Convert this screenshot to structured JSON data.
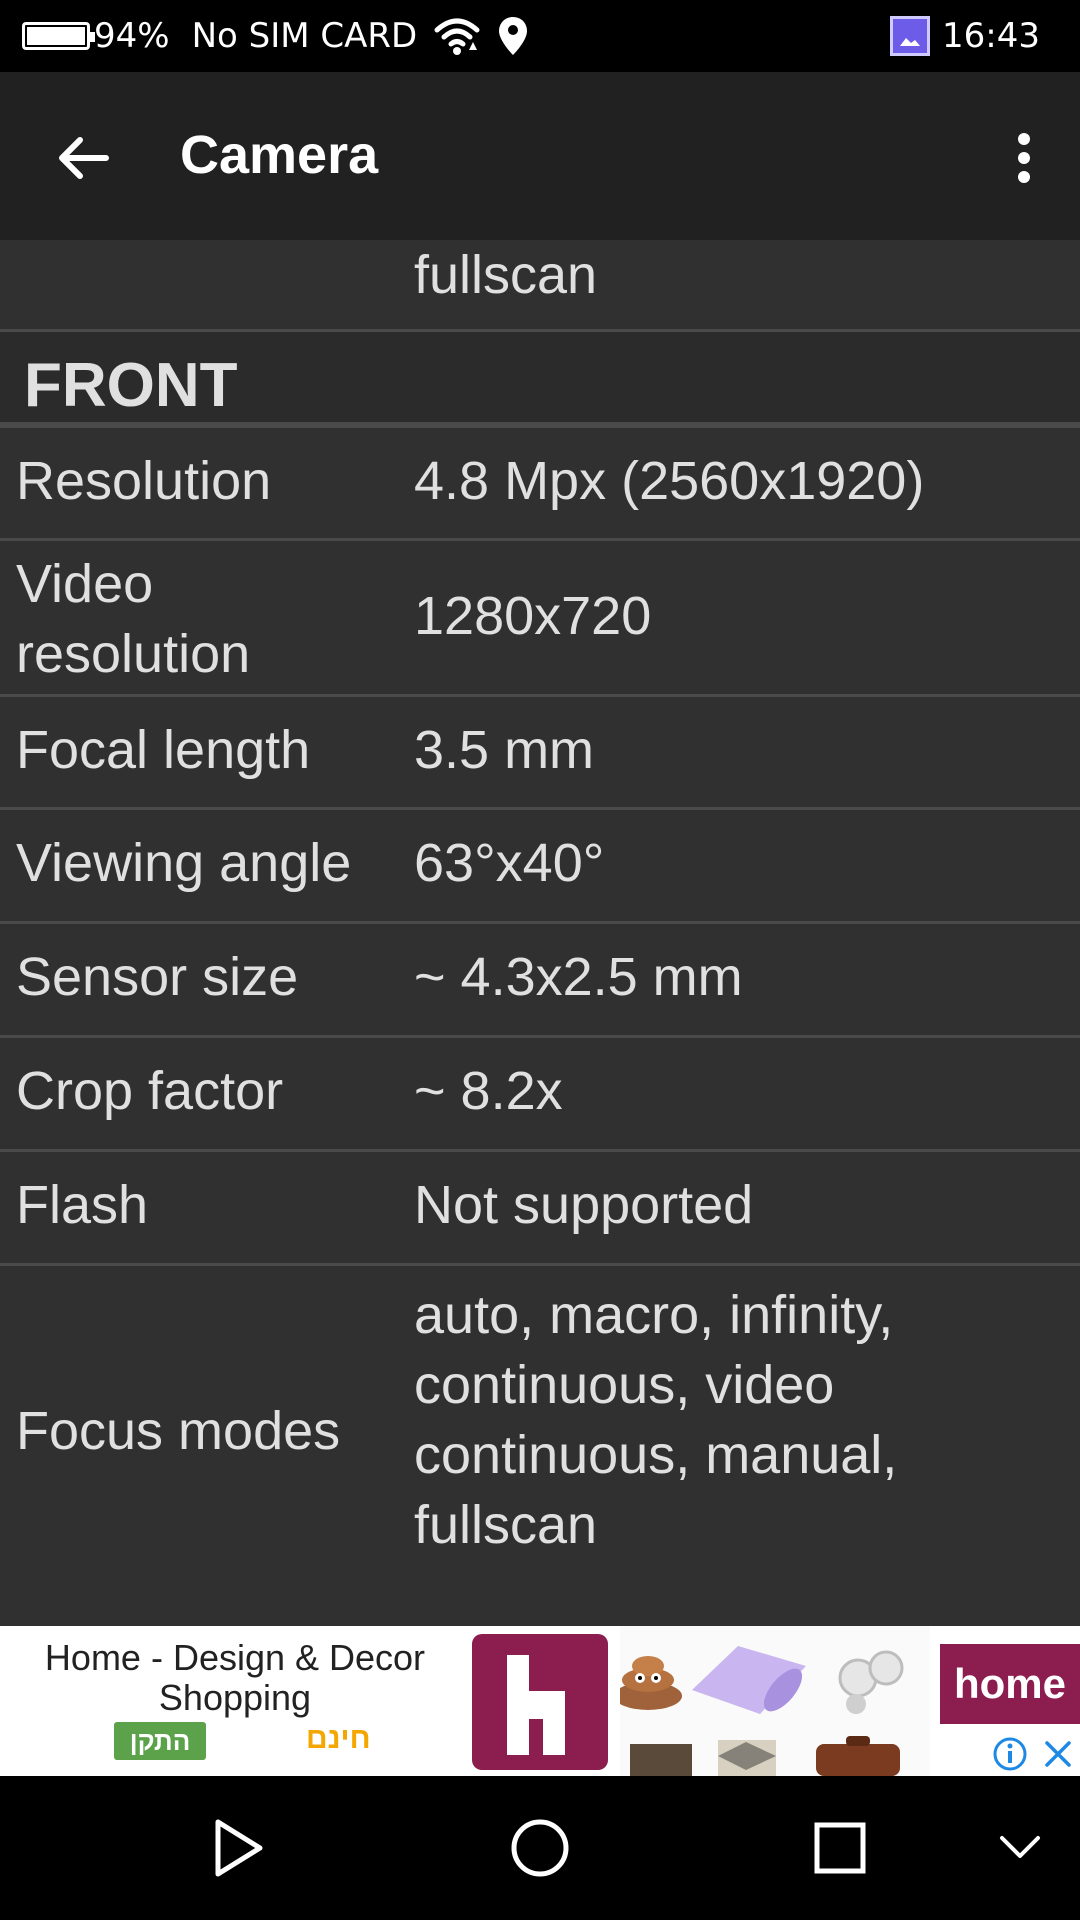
{
  "status_bar": {
    "battery_percent_text": "94%",
    "battery_level": 0.94,
    "carrier": "No SIM CARD",
    "time": "16:43"
  },
  "toolbar": {
    "title": "Camera",
    "back_icon": "arrow-left-icon",
    "more_icon": "more-vert-icon"
  },
  "content": {
    "partial_row_value": "fullscan",
    "section": "FRONT",
    "rows": [
      {
        "label": "Resolution",
        "value": "4.8 Mpx (2560x1920)"
      },
      {
        "label": "Video resolution",
        "value": "1280x720"
      },
      {
        "label": "Focal length",
        "value": "3.5 mm"
      },
      {
        "label": "Viewing angle",
        "value": "63°x40°"
      },
      {
        "label": "Sensor size",
        "value": "~ 4.3x2.5 mm"
      },
      {
        "label": "Crop factor",
        "value": "~ 8.2x"
      },
      {
        "label": "Flash",
        "value": "Not supported"
      },
      {
        "label": "Focus modes",
        "value": "auto, macro, infinity, continuous, video continuous, manual, fullscan"
      }
    ]
  },
  "ad": {
    "title": "Home - Design & Decor Shopping",
    "install_label": "התקן",
    "free_label": "חינם",
    "logo_letter": "h",
    "brand_text": "home",
    "brand_color": "#8c1d4f"
  },
  "nav_bar": {
    "back_icon": "play-back-icon",
    "home_icon": "circle-home-icon",
    "recents_icon": "square-recents-icon",
    "collapse_icon": "chevron-down-icon"
  }
}
